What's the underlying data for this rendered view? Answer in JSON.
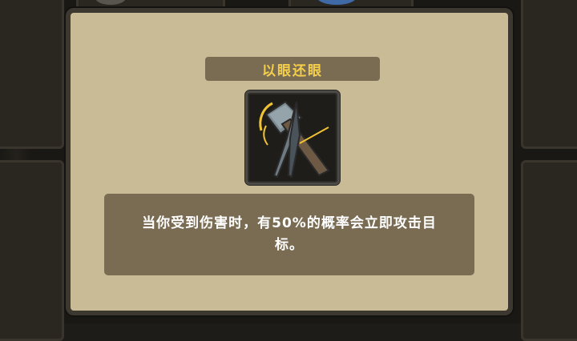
{
  "dialog": {
    "title": "以眼还眼",
    "description": "当你受到伤害时，有50%的概率会立即攻击目标。",
    "icon": "hammer-spear-icon"
  },
  "colors": {
    "panel": "#c8bb95",
    "bar": "#7a6c52",
    "title": "#f5cf4a",
    "text": "#ffffff"
  }
}
